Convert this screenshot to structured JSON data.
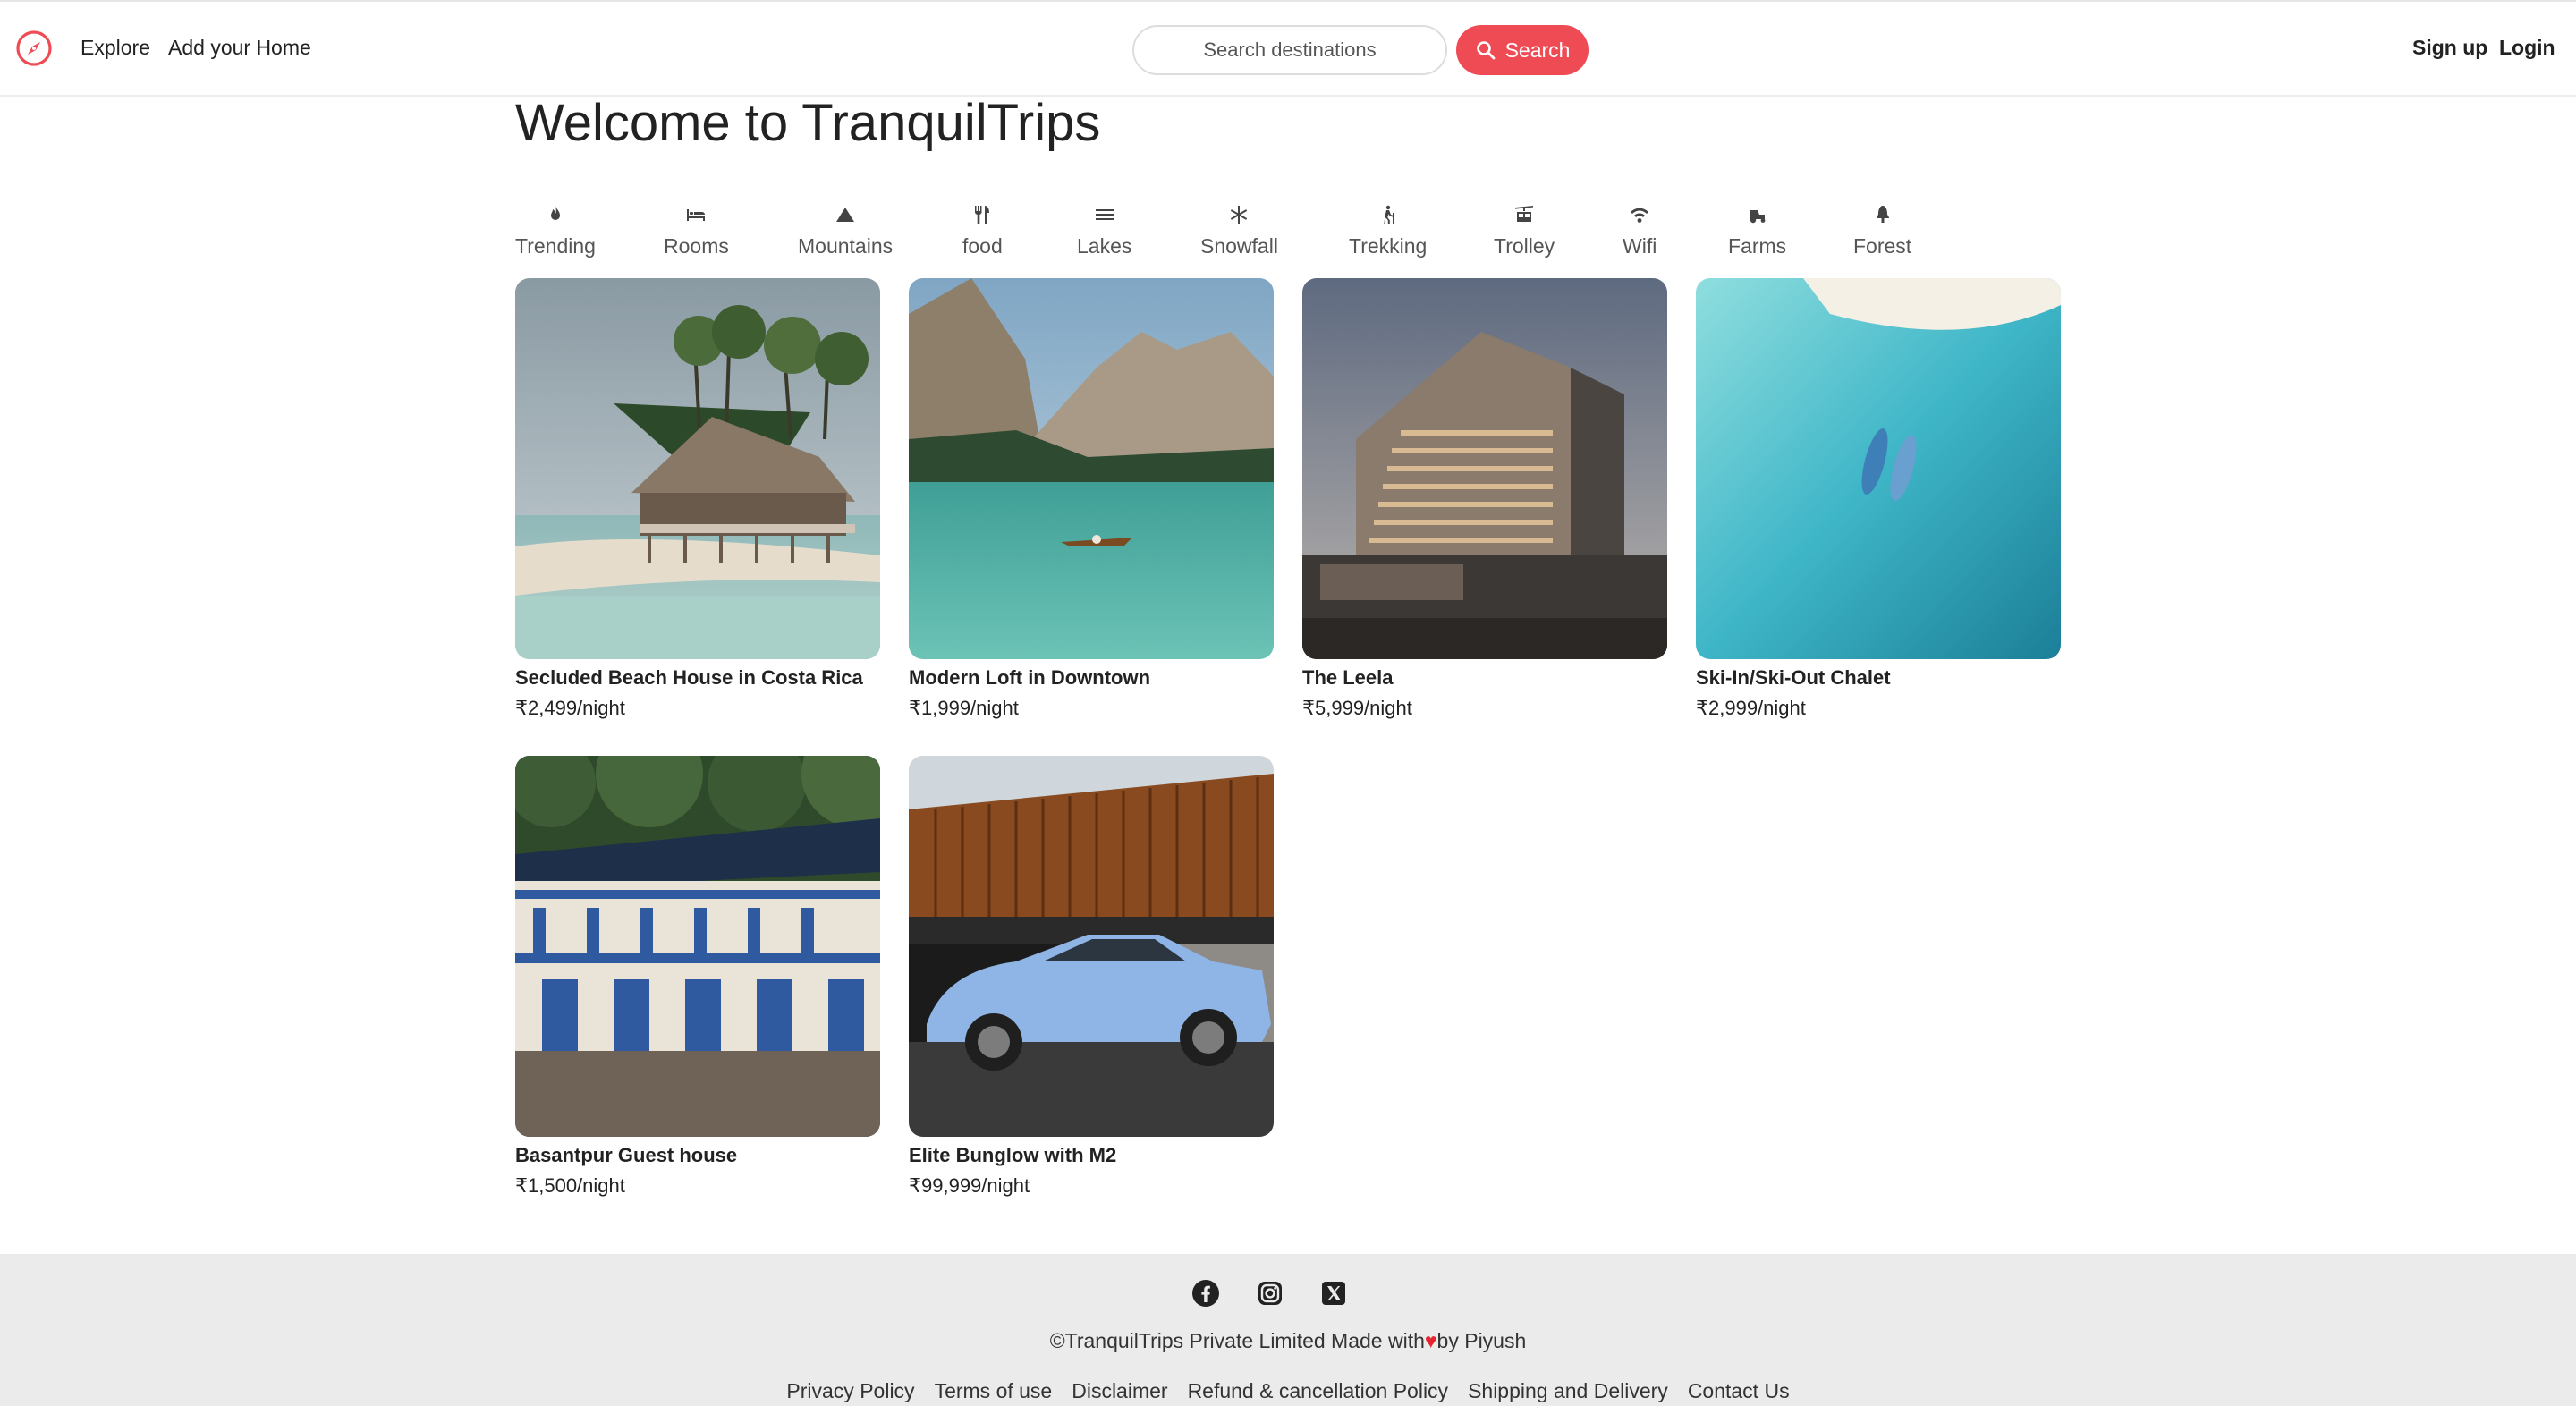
{
  "nav": {
    "logo_icon": "compass-icon",
    "explore": "Explore",
    "add_home": "Add your Home",
    "search_placeholder": "Search destinations",
    "search_button": "Search",
    "signup": "Sign up",
    "login": "Login"
  },
  "page": {
    "title": "Welcome to TranquilTrips"
  },
  "filters": [
    {
      "label": "Trending",
      "icon": "fire-icon"
    },
    {
      "label": "Rooms",
      "icon": "bed-icon"
    },
    {
      "label": "Mountains",
      "icon": "mountain-icon"
    },
    {
      "label": "food",
      "icon": "utensils-icon"
    },
    {
      "label": "Lakes",
      "icon": "water-icon"
    },
    {
      "label": "Snowfall",
      "icon": "snowflake-icon"
    },
    {
      "label": "Trekking",
      "icon": "hiking-icon"
    },
    {
      "label": "Trolley",
      "icon": "cable-car-icon"
    },
    {
      "label": "Wifi",
      "icon": "wifi-icon"
    },
    {
      "label": "Farms",
      "icon": "tractor-icon"
    },
    {
      "label": "Forest",
      "icon": "tree-icon"
    }
  ],
  "listings": [
    {
      "title": "Secluded Beach House in Costa Rica",
      "price": "₹2,499/night",
      "image": "beach-house-photo"
    },
    {
      "title": "Modern Loft in Downtown",
      "price": "₹1,999/night",
      "image": "mountain-lake-photo"
    },
    {
      "title": "The Leela",
      "price": "₹5,999/night",
      "image": "hotel-building-photo"
    },
    {
      "title": "Ski-In/Ski-Out Chalet",
      "price": "₹2,999/night",
      "image": "turquoise-sea-photo"
    },
    {
      "title": "Basantpur Guest house",
      "price": "₹1,500/night",
      "image": "guest-house-photo"
    },
    {
      "title": "Elite Bunglow with M2",
      "price": "₹99,999/night",
      "image": "car-bungalow-photo"
    }
  ],
  "footer": {
    "social": [
      "facebook-icon",
      "instagram-icon",
      "x-icon"
    ],
    "copyright_prefix": "©TranquilTrips Private Limited Made with",
    "copyright_heart": "♥",
    "copyright_suffix": "by Piyush",
    "links": [
      "Privacy Policy",
      "Terms of use",
      "Disclaimer",
      "Refund & cancellation Policy",
      "Shipping and Delivery",
      "Contact Us"
    ]
  },
  "colors": {
    "brand": "#ee4b55",
    "footer_bg": "#ebebeb",
    "text": "#222222"
  }
}
